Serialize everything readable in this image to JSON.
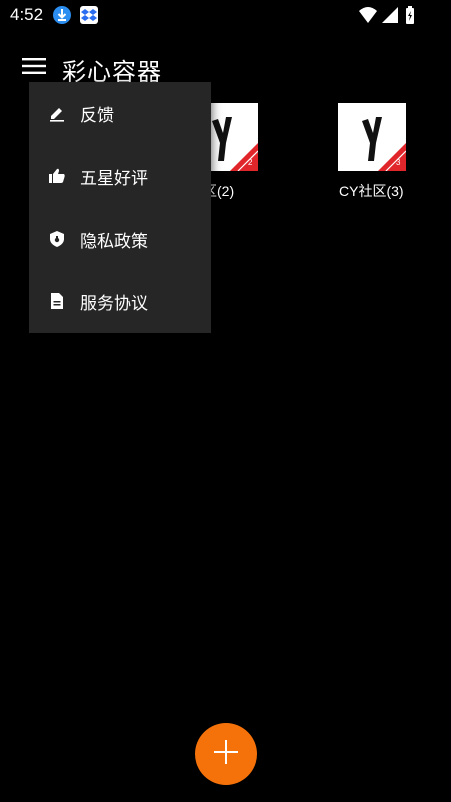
{
  "status_bar": {
    "time": "4:52",
    "icons": [
      "download-icon",
      "dropbox-icon",
      "wifi-icon",
      "signal-icon",
      "battery-charging-icon"
    ]
  },
  "app_bar": {
    "title": "彩心容器",
    "menu_icon": "hamburger-menu-icon"
  },
  "grid": {
    "items": [
      {
        "label": "社区(2)",
        "badge": "2"
      },
      {
        "label": "CY社区(3)",
        "badge": "3"
      }
    ]
  },
  "popup_menu": {
    "items": [
      {
        "label": "反馈",
        "icon": "edit-icon"
      },
      {
        "label": "五星好评",
        "icon": "thumbs-up-icon"
      },
      {
        "label": "隐私政策",
        "icon": "shield-icon"
      },
      {
        "label": "服务协议",
        "icon": "document-icon"
      }
    ]
  },
  "fab": {
    "icon": "plus-icon"
  },
  "colors": {
    "background": "#000000",
    "menu_bg": "#262626",
    "fab": "#f5720b",
    "status_blue": "#2b8ef0",
    "badge_red": "#e0262b"
  }
}
